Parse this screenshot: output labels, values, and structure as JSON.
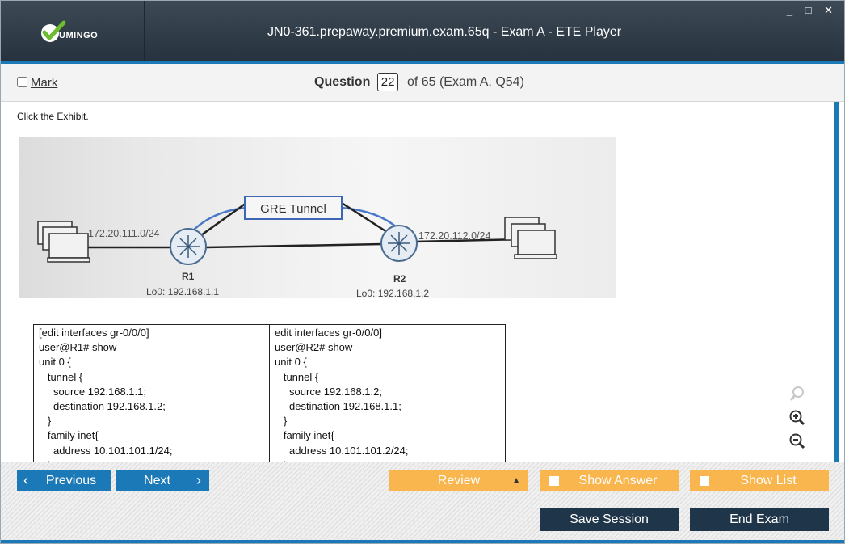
{
  "window": {
    "title": "JN0-361.prepaway.premium.exam.65q - Exam A - ETE Player",
    "controls": "_ □ ✕"
  },
  "logo": {
    "text": "UMINGO"
  },
  "question_bar": {
    "mark_label": "Mark",
    "question_label": "Question",
    "question_number": "22",
    "question_of": "of 65 (Exam A, Q54)"
  },
  "content": {
    "prompt": "Click the Exhibit.",
    "exhibit": {
      "tunnel_label": "GRE Tunnel",
      "r1_subnet": "172.20.111.0/24",
      "r2_subnet": "172.20.112.0/24",
      "r1_name": "R1",
      "r2_name": "R2",
      "r1_lo0": "Lo0: 192.168.1.1",
      "r2_lo0": "Lo0: 192.168.1.2"
    },
    "config": {
      "r1": [
        "[edit interfaces gr-0/0/0]",
        "user@R1# show",
        "unit 0 {",
        "   tunnel {",
        "     source 192.168.1.1;",
        "     destination 192.168.1.2;",
        "   }",
        "   family inet{",
        "     address 10.101.101.1/24;",
        "   }"
      ],
      "r2": [
        "edit interfaces gr-0/0/0]",
        "user@R2# show",
        "unit 0 {",
        "   tunnel {",
        "     source 192.168.1.2;",
        "     destination 192.168.1.1;",
        "   }",
        "   family inet{",
        "     address 10.101.101.2/24;",
        "   }"
      ]
    },
    "zoom_icons": [
      "zoom-reset-icon",
      "zoom-in-icon",
      "zoom-out-icon"
    ]
  },
  "footer": {
    "previous_label": "Previous",
    "next_label": "Next",
    "review_label": "Review",
    "show_answer_label": "Show Answer",
    "show_list_label": "Show List",
    "save_session_label": "Save Session",
    "end_exam_label": "End Exam"
  },
  "colors": {
    "accent_blue": "#1c79b8",
    "orange": "#f9b54e",
    "dark_navy": "#1f3549",
    "header_bg": "#2f3c48"
  }
}
